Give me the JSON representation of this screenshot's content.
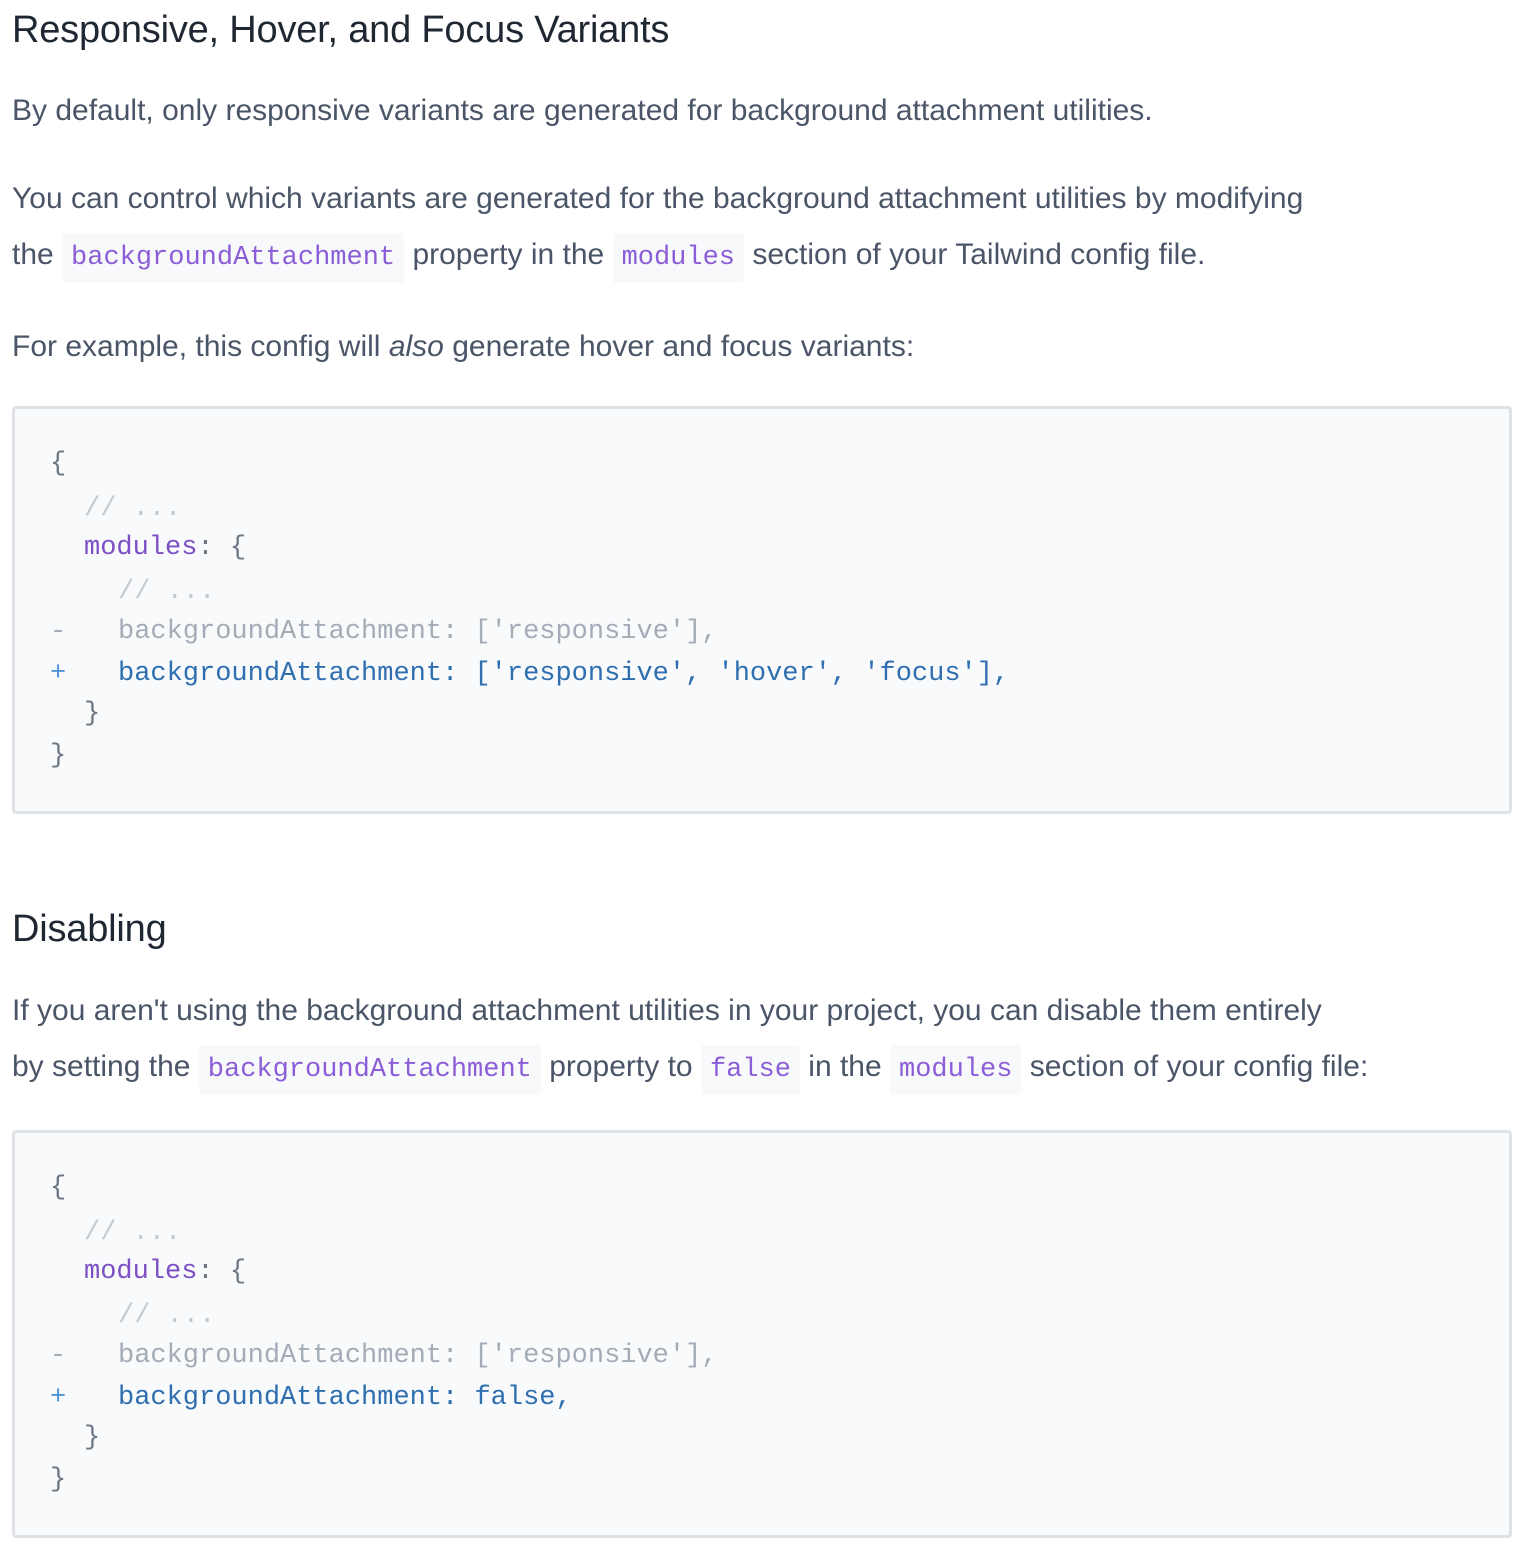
{
  "section1": {
    "title": "Responsive, Hover, and Focus Variants",
    "p1": "By default, only responsive variants are generated for background attachment utilities.",
    "p2": {
      "t1": "You can control which variants are generated for the background attachment utilities by modifying",
      "t2": "the ",
      "code1": "backgroundAttachment",
      "t3": " property in the ",
      "code2": "modules",
      "t4": " section of your Tailwind config file."
    },
    "p3": {
      "t1": "For example, this config will ",
      "em": "also",
      "t2": " generate hover and focus variants:"
    },
    "code": {
      "open_brace": "{",
      "comment_outer": "// ...",
      "modules_key": "modules",
      "modules_open": ": {",
      "comment_inner": "// ...",
      "removed_marker": "-",
      "removed_line": "backgroundAttachment: ['responsive'],",
      "added_marker": "+",
      "added_line": "backgroundAttachment: ['responsive', 'hover', 'focus'],",
      "inner_close": "}",
      "outer_close": "}"
    }
  },
  "section2": {
    "title": "Disabling",
    "p1": {
      "t1": "If you aren't using the background attachment utilities in your project, you can disable them entirely",
      "t2": "by setting the ",
      "code1": "backgroundAttachment",
      "t3": " property to ",
      "code2": "false",
      "t4": " in the ",
      "code3": "modules",
      "t5": " section of your config file:"
    },
    "code": {
      "open_brace": "{",
      "comment_outer": "// ...",
      "modules_key": "modules",
      "modules_open": ": {",
      "comment_inner": "// ...",
      "removed_marker": "-",
      "removed_line": "backgroundAttachment: ['responsive'],",
      "added_marker": "+",
      "added_line": "backgroundAttachment: false,",
      "inner_close": "}",
      "outer_close": "}"
    }
  }
}
